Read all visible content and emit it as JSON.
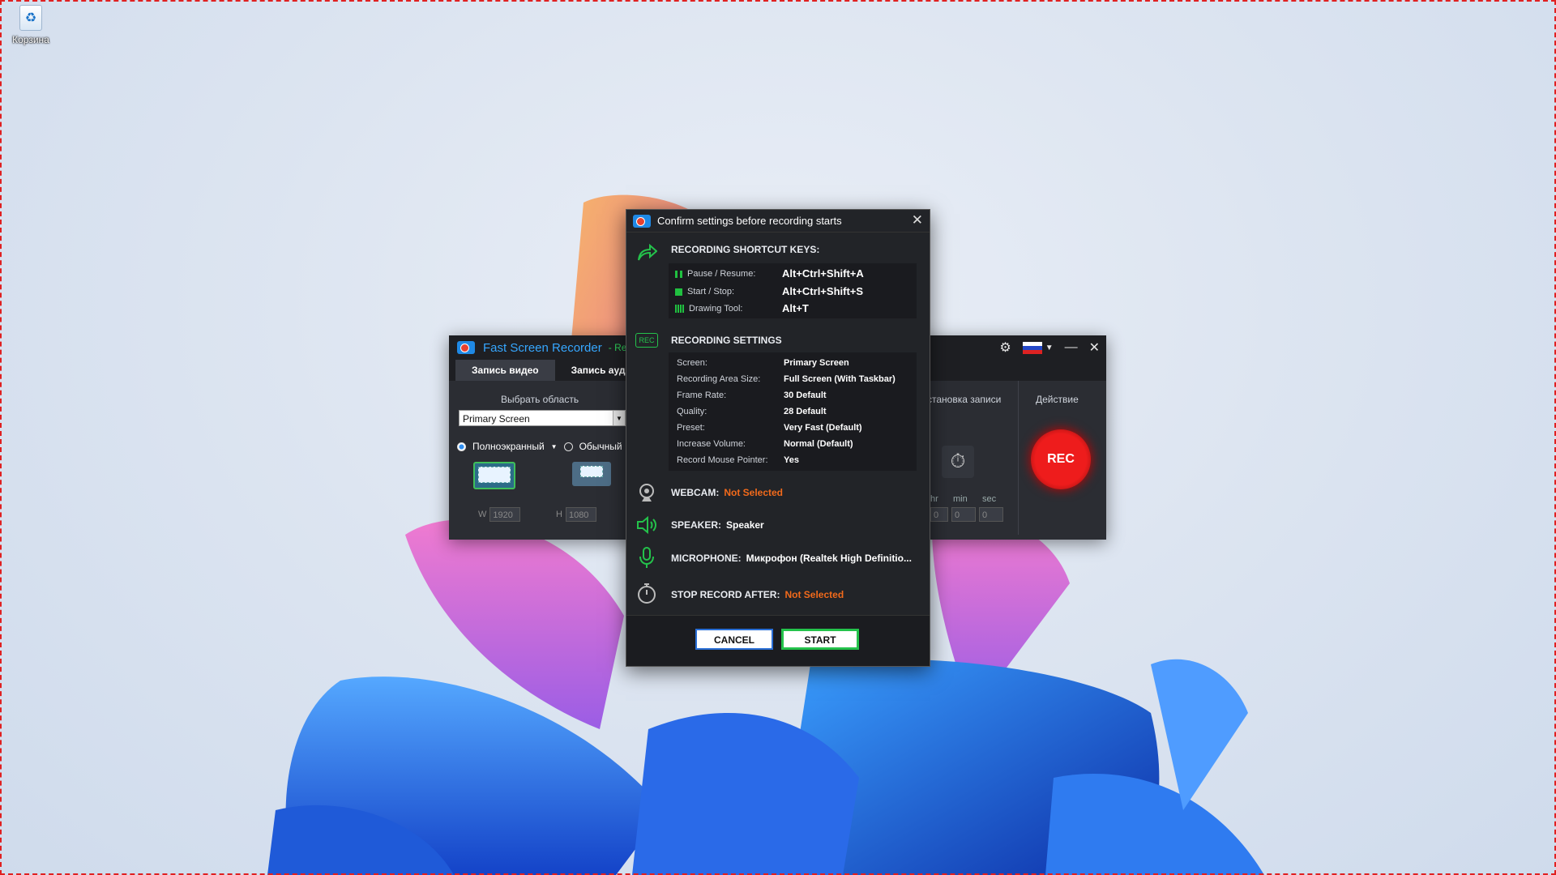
{
  "desktop": {
    "recycle_bin_label": "Корзина"
  },
  "app": {
    "title": "Fast Screen Recorder",
    "subtitle": "- Re",
    "tabs": [
      "Запись видео",
      "Запись ауд"
    ],
    "select_area_label": "Выбрать область",
    "screen_select_value": "Primary Screen",
    "mode_fullscreen": "Полноэкранный",
    "mode_normal": "Обычный",
    "w_label": "W",
    "w_value": "1920",
    "h_label": "H",
    "h_value": "1080",
    "stop_record_label": "становка записи",
    "action_label": "Действие",
    "hr_label": "hr",
    "min_label": "min",
    "sec_label": "sec",
    "timer_hr": "0",
    "timer_min": "0",
    "timer_sec": "0",
    "rec_label": "REC",
    "icons": [
      "gear-icon",
      "flag-ru-icon",
      "chevron-down-icon",
      "minimize-icon",
      "close-icon",
      "stopwatch-icon"
    ]
  },
  "dialog": {
    "title": "Confirm settings before recording starts",
    "shortcut_heading": "RECORDING SHORTCUT KEYS:",
    "shortcuts": [
      {
        "label": "Pause / Resume:",
        "keys": "Alt+Ctrl+Shift+A"
      },
      {
        "label": "Start / Stop:",
        "keys": "Alt+Ctrl+Shift+S"
      },
      {
        "label": "Drawing Tool:",
        "keys": "Alt+T"
      }
    ],
    "settings_heading": "RECORDING SETTINGS",
    "settings": [
      {
        "label": "Screen:",
        "value": "Primary Screen"
      },
      {
        "label": "Recording Area Size:",
        "value": "Full Screen (With Taskbar)"
      },
      {
        "label": "Frame Rate:",
        "value": "30 Default"
      },
      {
        "label": "Quality:",
        "value": "28 Default"
      },
      {
        "label": "Preset:",
        "value": "Very Fast (Default)"
      },
      {
        "label": "Increase Volume:",
        "value": "Normal (Default)"
      },
      {
        "label": "Record Mouse Pointer:",
        "value": "Yes"
      }
    ],
    "webcam_label": "WEBCAM:",
    "webcam_value": "Not Selected",
    "speaker_label": "SPEAKER:",
    "speaker_value": "Speaker",
    "microphone_label": "MICROPHONE:",
    "microphone_value": "Микрофон (Realtek High Definitio...",
    "stop_after_label": "STOP RECORD AFTER:",
    "stop_after_value": "Not Selected",
    "cancel_label": "CANCEL",
    "start_label": "START",
    "rec_badge": "REC"
  },
  "colors": {
    "accent_green": "#24c24b",
    "warning_orange": "#f26a1b",
    "rec_red": "#ee1c1c",
    "title_blue": "#36a7ff"
  }
}
